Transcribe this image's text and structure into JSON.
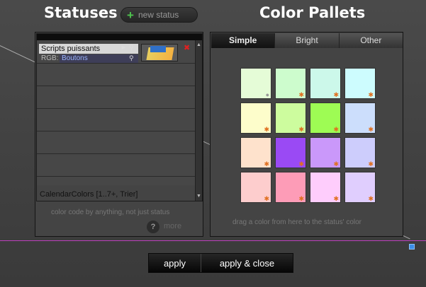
{
  "header": {
    "statuses_title": "Statuses",
    "pallets_title": "Color Pallets",
    "new_status_label": "new status"
  },
  "status_row": {
    "name": "Scripts puissants",
    "rgb_label": "RGB:",
    "rgb_value": "Boutons"
  },
  "calendar_colors": "CalendarColors [1..7+, Trier]",
  "status_hint": "color code by anything, not just status",
  "more_label": "more",
  "help_glyph": "?",
  "tabs": [
    {
      "label": "Simple"
    },
    {
      "label": "Bright"
    },
    {
      "label": "Other"
    }
  ],
  "pallet_hint": "drag a color from here to the status' color",
  "swatch_colors": [
    "#e5fcd7",
    "#cdfccd",
    "#ccf8ea",
    "#cdfcfe",
    "#fdfdcb",
    "#cdfc9e",
    "#9efc54",
    "#ccdefc",
    "#fee2cc",
    "#9a4af4",
    "#ca98fa",
    "#cdcdfc",
    "#fdcdcd",
    "#fd9cb7",
    "#fecdfc",
    "#e0cefe"
  ],
  "actions": {
    "apply_label": "apply",
    "apply_close_label": "apply & close"
  }
}
